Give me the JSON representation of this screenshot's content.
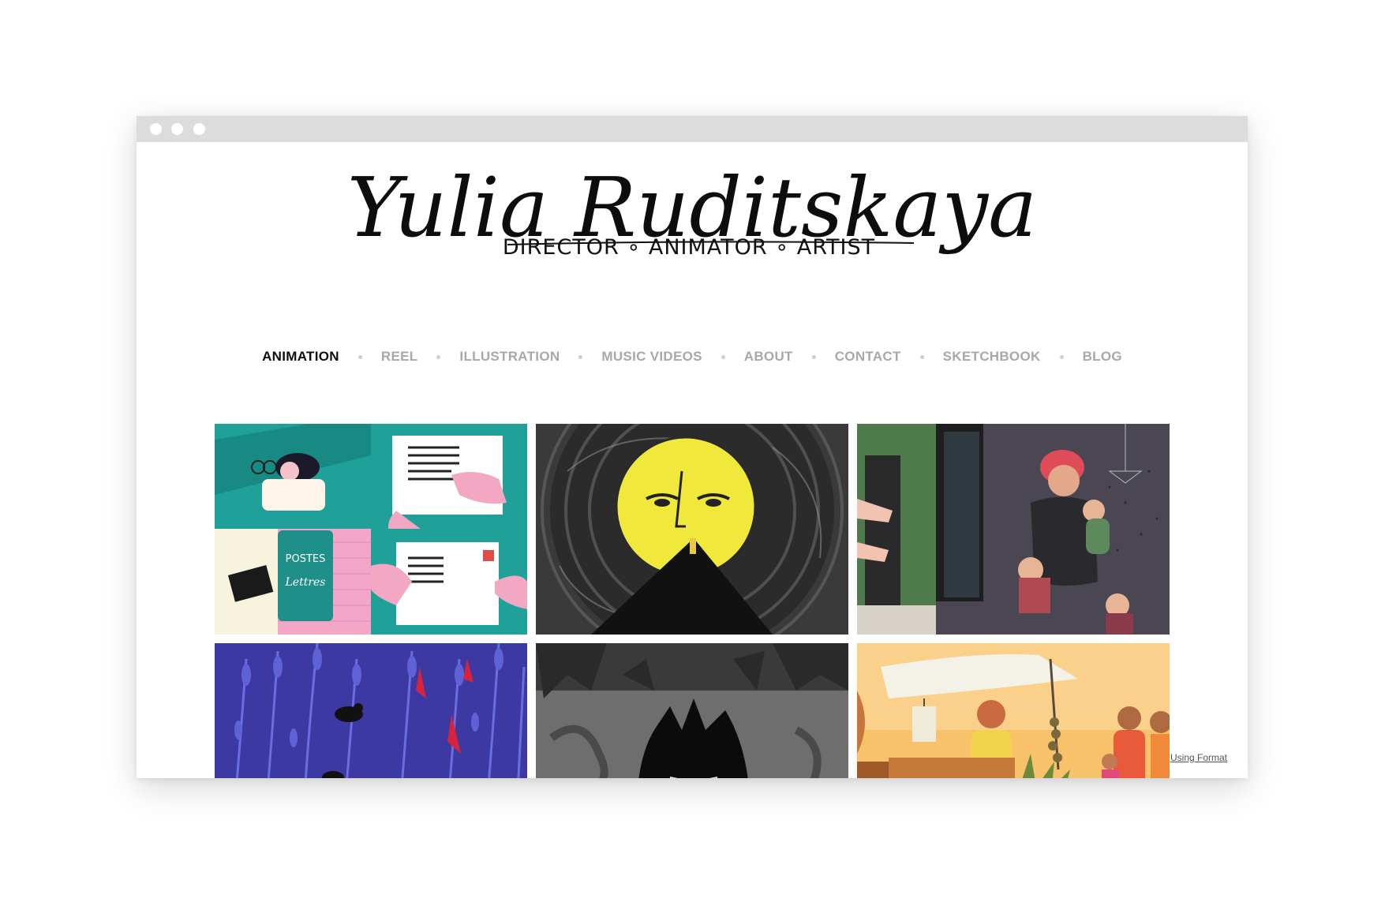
{
  "site": {
    "name": "Yulia Ruditskaya",
    "tagline": "DIRECTOR ∘ ANIMATOR ∘ ARTIST"
  },
  "nav": {
    "items": [
      {
        "label": "ANIMATION",
        "active": true
      },
      {
        "label": "REEL",
        "active": false
      },
      {
        "label": "ILLUSTRATION",
        "active": false
      },
      {
        "label": "MUSIC VIDEOS",
        "active": false
      },
      {
        "label": "ABOUT",
        "active": false
      },
      {
        "label": "CONTACT",
        "active": false
      },
      {
        "label": "SKETCHBOOK",
        "active": false
      },
      {
        "label": "BLOG",
        "active": false
      }
    ]
  },
  "gallery": {
    "tiles": [
      {
        "text": "POSTES",
        "text2": "Lettres"
      },
      {},
      {},
      {},
      {},
      {}
    ]
  },
  "footer": {
    "format_link": "Using Format"
  },
  "colors": {
    "nav_active": "#0d0d0d",
    "nav_inactive": "#a8a8a8",
    "titlebar": "#dcdcdc"
  }
}
